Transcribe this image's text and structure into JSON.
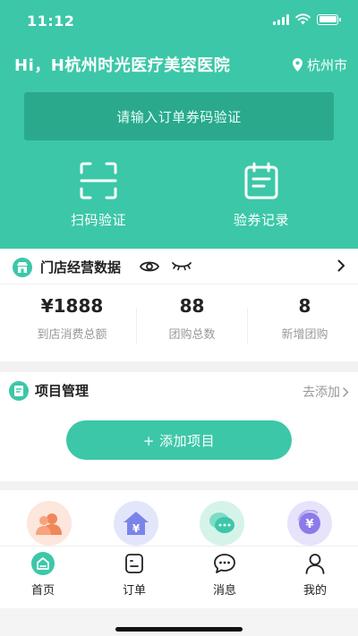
{
  "status_bar": {
    "time": "11:12"
  },
  "header": {
    "greeting": "Hi，H杭州时光医疗美容医院",
    "location": "杭州市",
    "verify_placeholder": "请输入订单券码验证",
    "actions": [
      {
        "label": "扫码验证",
        "icon": "scan-icon"
      },
      {
        "label": "验券记录",
        "icon": "calendar-icon"
      }
    ]
  },
  "store_stats": {
    "title": "门店经营数据",
    "items": [
      {
        "value": "¥1888",
        "label": "到店消费总额"
      },
      {
        "value": "88",
        "label": "团购总数"
      },
      {
        "value": "8",
        "label": "新增团购"
      }
    ]
  },
  "project": {
    "title": "项目管理",
    "add_link": "去添加",
    "add_button": "+ 添加项目"
  },
  "features": [
    {
      "icon": "users-icon",
      "color": "#fde6dc"
    },
    {
      "icon": "store-yen-icon",
      "color": "#e3e6fb"
    },
    {
      "icon": "chat-icon",
      "color": "#d6f3ea"
    },
    {
      "icon": "yen-refund-icon",
      "color": "#e6e3fb"
    }
  ],
  "tabbar": {
    "tabs": [
      {
        "label": "首页",
        "icon": "home-icon",
        "active": true
      },
      {
        "label": "订单",
        "icon": "order-icon",
        "active": false
      },
      {
        "label": "消息",
        "icon": "message-icon",
        "active": false
      },
      {
        "label": "我的",
        "icon": "profile-icon",
        "active": false
      }
    ]
  },
  "colors": {
    "accent": "#3cc7a8",
    "accent_dark": "#2aa98d"
  }
}
